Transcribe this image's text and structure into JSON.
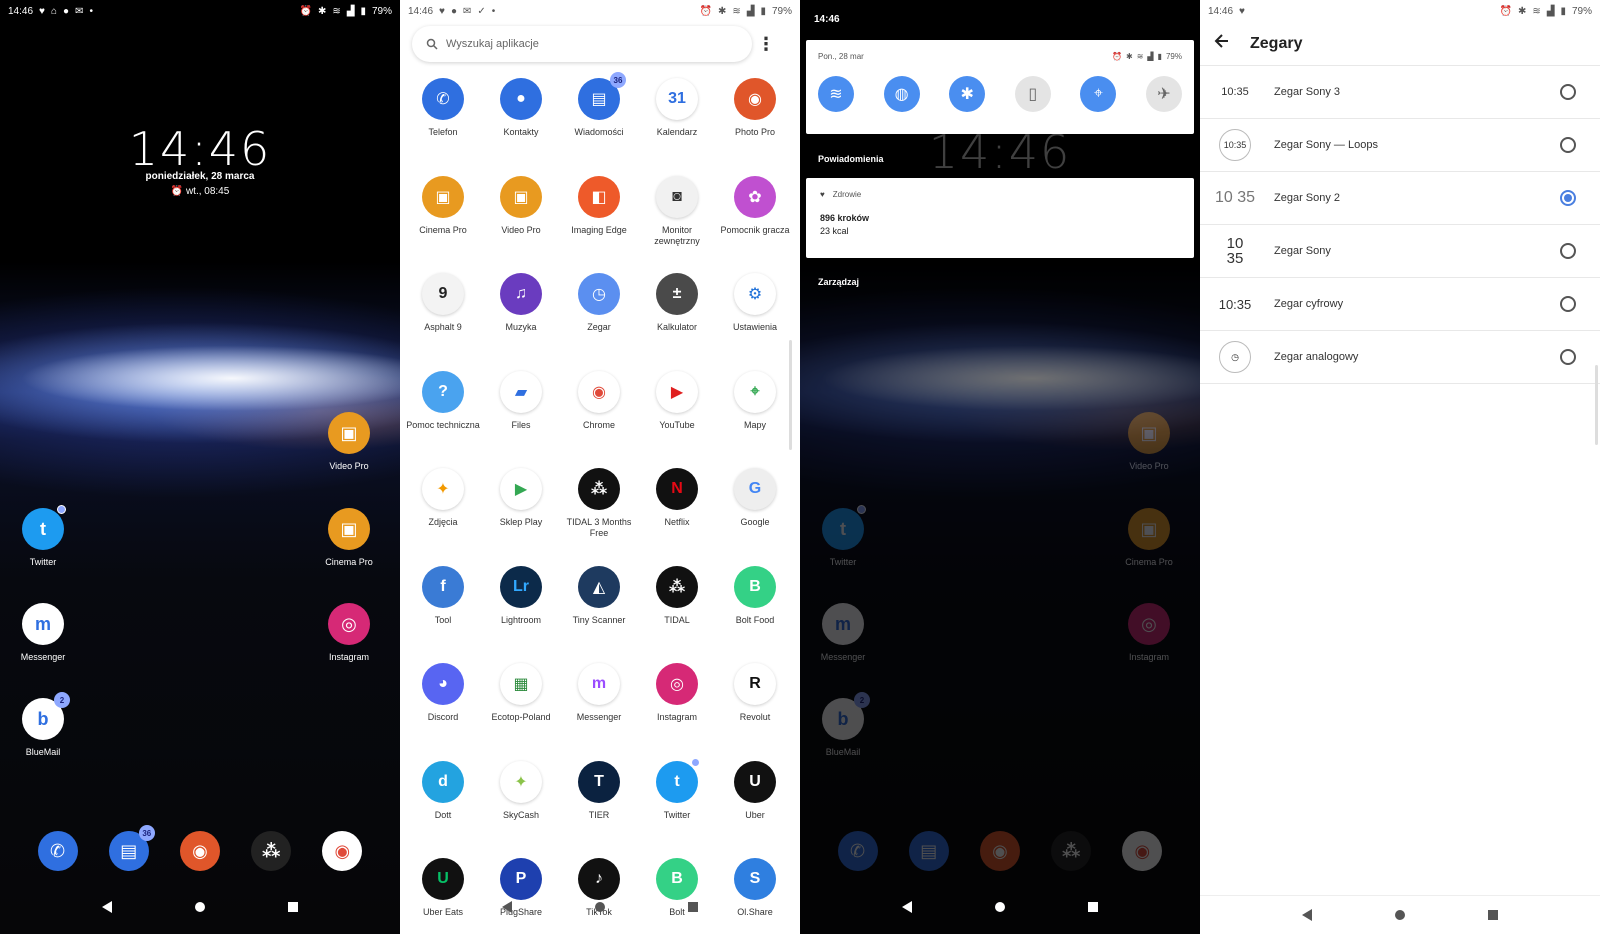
{
  "status": {
    "time": "14:46",
    "battery": "79%"
  },
  "home": {
    "clock": "14:46",
    "date": "poniedziałek, 28 marca",
    "alarm": "wt., 08:45",
    "icons": [
      {
        "label": "Video Pro",
        "color": "#e89a20",
        "glyph": "▣"
      },
      {
        "label": "Twitter",
        "color": "#1d9bf0",
        "glyph": "t"
      },
      {
        "label": "Cinema Pro",
        "color": "#e89a20",
        "glyph": "▣"
      },
      {
        "label": "Messenger",
        "color": "#ffffff",
        "glyph": "m"
      },
      {
        "label": "Instagram",
        "color": "#d62976",
        "glyph": "◎"
      },
      {
        "label": "BlueMail",
        "color": "#ffffff",
        "glyph": "b",
        "badge": "2"
      }
    ],
    "dock_badge": "36"
  },
  "drawer": {
    "search_placeholder": "Wyszukaj aplikacje",
    "apps": [
      {
        "label": "Telefon",
        "color": "#2f6fe0",
        "glyph": "✆"
      },
      {
        "label": "Kontakty",
        "color": "#2f6fe0",
        "glyph": "●"
      },
      {
        "label": "Wiadomości",
        "color": "#2f6fe0",
        "glyph": "▤",
        "badge": "36"
      },
      {
        "label": "Kalendarz",
        "color": "#ffffff",
        "glyph": "31",
        "fg": "#2f6fe0"
      },
      {
        "label": "Photo Pro",
        "color": "#e0562a",
        "glyph": "◉"
      },
      {
        "label": "Cinema Pro",
        "color": "#e89a20",
        "glyph": "▣"
      },
      {
        "label": "Video Pro",
        "color": "#e89a20",
        "glyph": "▣"
      },
      {
        "label": "Imaging Edge",
        "color": "#ee5a2a",
        "glyph": "◧"
      },
      {
        "label": "Monitor zewnętrzny",
        "color": "#f1f1f1",
        "glyph": "◙",
        "fg": "#333"
      },
      {
        "label": "Pomocnik gracza",
        "color": "#c050d0",
        "glyph": "✿"
      },
      {
        "label": "Asphalt 9",
        "color": "#f3f3f3",
        "glyph": "9",
        "fg": "#222"
      },
      {
        "label": "Muzyka",
        "color": "#6a3cbf",
        "glyph": "♫"
      },
      {
        "label": "Zegar",
        "color": "#5b8ff0",
        "glyph": "◷"
      },
      {
        "label": "Kalkulator",
        "color": "#4a4a4a",
        "glyph": "±"
      },
      {
        "label": "Ustawienia",
        "color": "#ffffff",
        "glyph": "⚙",
        "fg": "#1e70d8"
      },
      {
        "label": "Pomoc techniczna",
        "color": "#4aa3ef",
        "glyph": "?"
      },
      {
        "label": "Files",
        "color": "#ffffff",
        "glyph": "▰",
        "fg": "#2f6fe0"
      },
      {
        "label": "Chrome",
        "color": "#ffffff",
        "glyph": "◉",
        "fg": "#e04a3a"
      },
      {
        "label": "YouTube",
        "color": "#ffffff",
        "glyph": "▶",
        "fg": "#e02020"
      },
      {
        "label": "Mapy",
        "color": "#ffffff",
        "glyph": "⌖",
        "fg": "#34a853"
      },
      {
        "label": "Zdjęcia",
        "color": "#ffffff",
        "glyph": "✦",
        "fg": "#f29900"
      },
      {
        "label": "Sklep Play",
        "color": "#ffffff",
        "glyph": "▶",
        "fg": "#34a853"
      },
      {
        "label": "TIDAL 3 Months Free",
        "color": "#111111",
        "glyph": "⁂"
      },
      {
        "label": "Netflix",
        "color": "#111111",
        "glyph": "N",
        "fg": "#e50914"
      },
      {
        "label": "Google",
        "color": "#eeeeee",
        "glyph": "G",
        "fg": "#4285f4"
      },
      {
        "label": "Tool",
        "color": "#3a7bd5",
        "glyph": "f"
      },
      {
        "label": "Lightroom",
        "color": "#0c2a4a",
        "glyph": "Lr",
        "fg": "#31a8ff"
      },
      {
        "label": "Tiny Scanner",
        "color": "#1e3a5f",
        "glyph": "◭"
      },
      {
        "label": "TIDAL",
        "color": "#111111",
        "glyph": "⁂"
      },
      {
        "label": "Bolt Food",
        "color": "#34d186",
        "glyph": "B"
      },
      {
        "label": "Discord",
        "color": "#5865f2",
        "glyph": "◕"
      },
      {
        "label": "Ecotop-Poland",
        "color": "#ffffff",
        "glyph": "▦",
        "fg": "#2e8b3e"
      },
      {
        "label": "Messenger",
        "color": "#ffffff",
        "glyph": "m",
        "fg": "#9b4dff"
      },
      {
        "label": "Instagram",
        "color": "#d62976",
        "glyph": "◎"
      },
      {
        "label": "Revolut",
        "color": "#ffffff",
        "glyph": "R",
        "fg": "#111"
      },
      {
        "label": "Dott",
        "color": "#23a3e0",
        "glyph": "d"
      },
      {
        "label": "SkyCash",
        "color": "#ffffff",
        "glyph": "✦",
        "fg": "#8bc34a"
      },
      {
        "label": "TIER",
        "color": "#0b2240",
        "glyph": "T"
      },
      {
        "label": "Twitter",
        "color": "#1d9bf0",
        "glyph": "t",
        "dot": true
      },
      {
        "label": "Uber",
        "color": "#111111",
        "glyph": "U"
      },
      {
        "label": "Uber Eats",
        "color": "#111111",
        "glyph": "U",
        "fg": "#06c167"
      },
      {
        "label": "PlugShare",
        "color": "#1e40af",
        "glyph": "P"
      },
      {
        "label": "TikTok",
        "color": "#111111",
        "glyph": "♪"
      },
      {
        "label": "Bolt",
        "color": "#34d186",
        "glyph": "B"
      },
      {
        "label": "Ol.Share",
        "color": "#2f7fe0",
        "glyph": "S"
      }
    ]
  },
  "shade": {
    "time": "14:46",
    "date": "Pon., 28 mar",
    "battery": "79%",
    "notifications_header": "Powiadomienia",
    "notification": {
      "app": "Zdrowie",
      "title": "896 kroków",
      "sub": "23 kcal"
    },
    "manage": "Zarządzaj",
    "ghost_labels": [
      "Video Pro",
      "Twitter",
      "Cinema Pro",
      "Messenger",
      "Instagram",
      "BlueMail"
    ]
  },
  "settings": {
    "title": "Zegary",
    "battery": "79%",
    "clocks": [
      {
        "preview": "10:35",
        "name": "Zegar Sony 3",
        "selected": false
      },
      {
        "preview": "10:35",
        "name": "Zegar Sony — Loops",
        "selected": false
      },
      {
        "preview": "10 35",
        "name": "Zegar Sony 2",
        "selected": true
      },
      {
        "preview": "10\n35",
        "name": "Zegar Sony",
        "selected": false
      },
      {
        "preview": "10:35",
        "name": "Zegar cyfrowy",
        "selected": false
      },
      {
        "preview": "◷",
        "name": "Zegar analogowy",
        "selected": false
      }
    ]
  }
}
